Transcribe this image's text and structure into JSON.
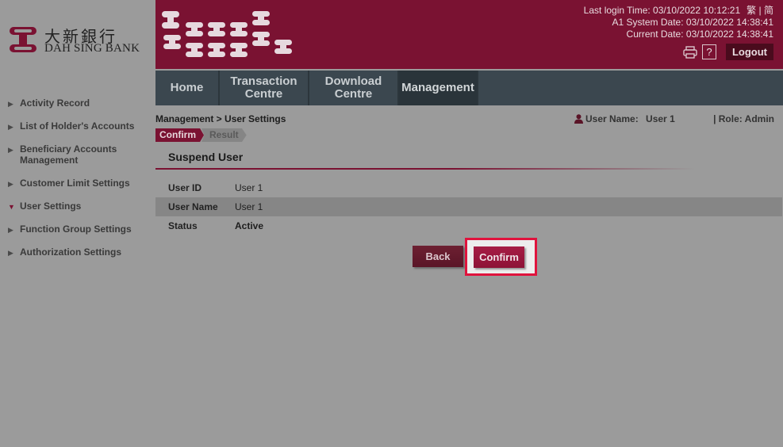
{
  "logo": {
    "chinese": "大新銀行",
    "english_dah": "DAH",
    "english_rest": " SING BANK",
    "icon": "dah-sing-logo-icon"
  },
  "header": {
    "last_login": "Last login Time: 03/10/2022 10:12:21",
    "lang_trad": "繁",
    "lang_sep": "|",
    "lang_simp": "简",
    "system_date": "A1 System Date: 03/10/2022 14:38:41",
    "current_date": "Current Date: 03/10/2022 14:38:41",
    "help_label": "?",
    "logout_label": "Logout",
    "print_icon": "printer-icon"
  },
  "nav": {
    "tabs": [
      {
        "line1": "Home",
        "line2": ""
      },
      {
        "line1": "Transaction",
        "line2": "Centre"
      },
      {
        "line1": "Download",
        "line2": "Centre"
      },
      {
        "line1": "Management",
        "line2": ""
      }
    ],
    "active": "Management"
  },
  "sidebar": {
    "items": [
      {
        "line1": "Activity Record",
        "line2": ""
      },
      {
        "line1": "List of Holder's Accounts",
        "line2": ""
      },
      {
        "line1": "Beneficiary Accounts",
        "line2": "Management"
      },
      {
        "line1": "Customer Limit Settings",
        "line2": ""
      },
      {
        "line1": "User Settings",
        "line2": ""
      },
      {
        "line1": "Function Group Settings",
        "line2": ""
      },
      {
        "line1": "Authorization Settings",
        "line2": ""
      }
    ],
    "active": "User Settings"
  },
  "breadcrumb": "Management > User Settings",
  "user": {
    "name_label": "User Name:",
    "name_value": "User 1",
    "role": "| Role: Admin",
    "icon": "user-icon"
  },
  "steps": {
    "current": "Confirm",
    "next": "Result"
  },
  "section_title": "Suspend User",
  "details": [
    {
      "label": "User ID",
      "value": "User 1"
    },
    {
      "label": "User Name",
      "value": "User 1"
    },
    {
      "label": "Status",
      "value": "Active"
    }
  ],
  "buttons": {
    "back": "Back",
    "confirm": "Confirm"
  },
  "colors": {
    "brand": "#7a1232",
    "nav": "#3b474f",
    "highlight": "#e0133d"
  }
}
